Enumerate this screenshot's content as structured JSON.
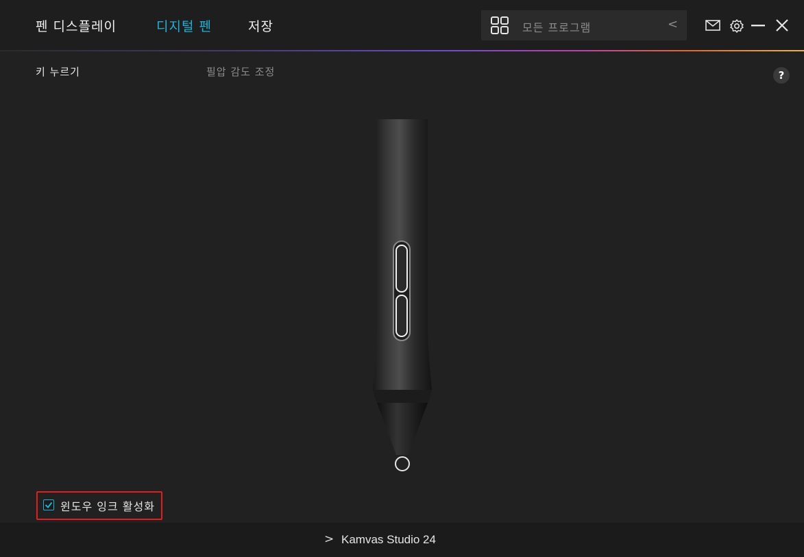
{
  "header": {
    "tabs": [
      {
        "label": "펜 디스플레이",
        "active": false
      },
      {
        "label": "디지털 펜",
        "active": true
      },
      {
        "label": "저장",
        "active": false
      }
    ],
    "program_selector": {
      "label": "모든 프로그램",
      "icon": "grid-icon",
      "arrow": "<"
    },
    "window_controls": {
      "mail_icon": "mail-icon",
      "settings_icon": "gear-icon",
      "minimize_icon": "minimize-icon",
      "close_icon": "close-icon"
    }
  },
  "subtabs": [
    {
      "label": "키 누르기",
      "active": true
    },
    {
      "label": "필압 감도 조정",
      "active": false
    }
  ],
  "help": {
    "label": "?"
  },
  "pen_image": {
    "name": "digital-pen-illustration"
  },
  "checkbox": {
    "label": "윈도우 잉크 활성화",
    "checked": true
  },
  "footer": {
    "arrow": ">",
    "device": "Kamvas Studio 24"
  },
  "colors": {
    "background": "#212121",
    "accent": "#20b2d6",
    "highlight": "#e02020",
    "text": "#e6e6e6",
    "muted": "#8c8c8c"
  }
}
